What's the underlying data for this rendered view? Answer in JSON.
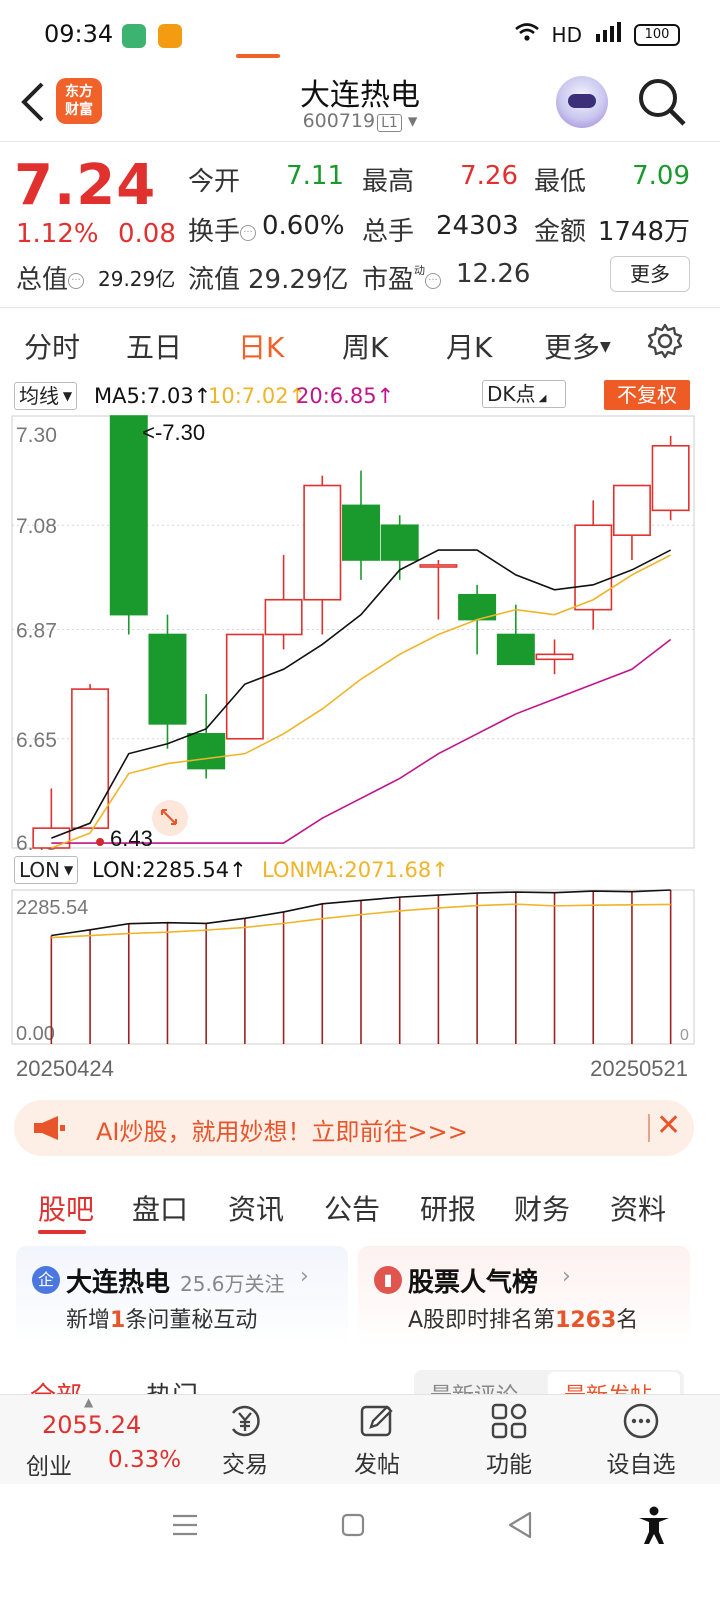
{
  "status_bar": {
    "time": "09:34",
    "network": "HD",
    "battery": "100"
  },
  "header": {
    "stock_name": "大连热电",
    "stock_code": "600719",
    "level": "L1",
    "logo_text": "东方财富"
  },
  "quote": {
    "price": "7.24",
    "change_pct": "1.12%",
    "change_abs": "0.08",
    "open_label": "今开",
    "open": "7.11",
    "high_label": "最高",
    "high": "7.26",
    "low_label": "最低",
    "low": "7.09",
    "turnover_label": "换手",
    "turnover": "0.60%",
    "volume_label": "总手",
    "volume": "24303",
    "amount_label": "金额",
    "amount": "1748万",
    "mktcap_label": "总值",
    "mktcap": "29.29亿",
    "float_label": "流值",
    "float": "29.29亿",
    "pe_label": "市盈",
    "pe_sup": "动",
    "pe": "12.26",
    "more_label": "更多"
  },
  "chart_tabs": [
    "分时",
    "五日",
    "日K",
    "周K",
    "月K",
    "更多"
  ],
  "ma_row": {
    "dropdown": "均线",
    "ma5": "MA5:7.03↑",
    "ma10": "10:7.02↑",
    "ma20": "20:6.85↑",
    "dk": "DK点",
    "unadjusted": "不复权"
  },
  "lon_row": {
    "dropdown": "LON",
    "lon": "LON:2285.54↑",
    "lonma": "LONMA:2071.68↑"
  },
  "colors": {
    "up": "#e0312f",
    "down": "#1a9a2c",
    "accent": "#f0622a",
    "ma5": "#111111",
    "ma10": "#f0b429",
    "ma20": "#c0158a"
  },
  "chart_data": [
    {
      "type": "candlestick",
      "ylim": [
        6.43,
        7.3
      ],
      "y_ticks": [
        "7.30",
        "7.08",
        "6.87",
        "6.65",
        "6.43"
      ],
      "max_label": "7.30",
      "min_label": "6.43",
      "candles": [
        {
          "o": 6.43,
          "c": 6.47,
          "h": 6.55,
          "l": 6.43
        },
        {
          "o": 6.47,
          "c": 6.75,
          "h": 6.76,
          "l": 6.47
        },
        {
          "o": 7.3,
          "c": 6.9,
          "h": 7.3,
          "l": 6.86
        },
        {
          "o": 6.86,
          "c": 6.68,
          "h": 6.9,
          "l": 6.63
        },
        {
          "o": 6.66,
          "c": 6.59,
          "h": 6.74,
          "l": 6.57
        },
        {
          "o": 6.65,
          "c": 6.86,
          "h": 6.86,
          "l": 6.65
        },
        {
          "o": 6.86,
          "c": 6.93,
          "h": 7.02,
          "l": 6.83
        },
        {
          "o": 6.93,
          "c": 7.16,
          "h": 7.18,
          "l": 6.86
        },
        {
          "o": 7.12,
          "c": 7.01,
          "h": 7.19,
          "l": 6.97
        },
        {
          "o": 7.08,
          "c": 7.01,
          "h": 7.1,
          "l": 6.97
        },
        {
          "o": 7.0,
          "c": 7.0,
          "h": 7.01,
          "l": 6.89
        },
        {
          "o": 6.94,
          "c": 6.89,
          "h": 6.96,
          "l": 6.82
        },
        {
          "o": 6.86,
          "c": 6.8,
          "h": 6.92,
          "l": 6.8
        },
        {
          "o": 6.81,
          "c": 6.82,
          "h": 6.85,
          "l": 6.78
        },
        {
          "o": 6.91,
          "c": 7.08,
          "h": 7.13,
          "l": 6.87
        },
        {
          "o": 7.06,
          "c": 7.16,
          "h": 7.16,
          "l": 7.01
        },
        {
          "o": 7.11,
          "c": 7.24,
          "h": 7.26,
          "l": 7.09
        }
      ],
      "ma5": [
        6.45,
        6.48,
        6.62,
        6.64,
        6.67,
        6.76,
        6.79,
        6.84,
        6.9,
        6.99,
        7.03,
        7.03,
        6.98,
        6.95,
        6.96,
        6.99,
        7.03
      ],
      "ma10": [
        6.43,
        6.46,
        6.58,
        6.6,
        6.61,
        6.62,
        6.66,
        6.71,
        6.77,
        6.82,
        6.86,
        6.89,
        6.91,
        6.9,
        6.93,
        6.98,
        7.02
      ],
      "ma20": [
        6.44,
        6.44,
        6.44,
        6.44,
        6.44,
        6.44,
        6.44,
        6.49,
        6.53,
        6.57,
        6.62,
        6.66,
        6.7,
        6.73,
        6.76,
        6.79,
        6.85
      ]
    },
    {
      "type": "line",
      "ylim": [
        0,
        2285.54
      ],
      "y_ticks": [
        "2285.54",
        "0.00"
      ],
      "x_start": "20250424",
      "x_end": "20250521",
      "right_zero": "0",
      "lon": [
        1610,
        1695,
        1785,
        1800,
        1790,
        1865,
        1960,
        2080,
        2130,
        2180,
        2210,
        2240,
        2255,
        2245,
        2270,
        2260,
        2285.54
      ],
      "lonma": [
        1580,
        1610,
        1640,
        1660,
        1690,
        1730,
        1790,
        1860,
        1920,
        1975,
        2020,
        2055,
        2075,
        2050,
        2060,
        2065,
        2071.68
      ]
    }
  ],
  "banner": {
    "text": "AI炒股，就用妙想！立即前往>>>"
  },
  "sub_tabs": [
    "股吧",
    "盘口",
    "资讯",
    "公告",
    "研报",
    "财务",
    "资料"
  ],
  "card_left": {
    "badge": "企",
    "title": "大连热电",
    "followers": "25.6万关注",
    "sub_prefix": "新增",
    "sub_count": "1",
    "sub_suffix": "条问董秘互动"
  },
  "card_right": {
    "title": "股票人气榜",
    "sub_prefix": "A股即时排名第",
    "sub_rank": "1263",
    "sub_suffix": "名"
  },
  "feed_peek": {
    "left1": "全部",
    "left2": "热门",
    "right1": "最新评论",
    "right2": "最新发帖"
  },
  "bottom_nav": {
    "index_value": "2055.24",
    "index_name": "创业",
    "index_change": "0.33%",
    "items": [
      "交易",
      "发帖",
      "功能",
      "设自选"
    ]
  }
}
